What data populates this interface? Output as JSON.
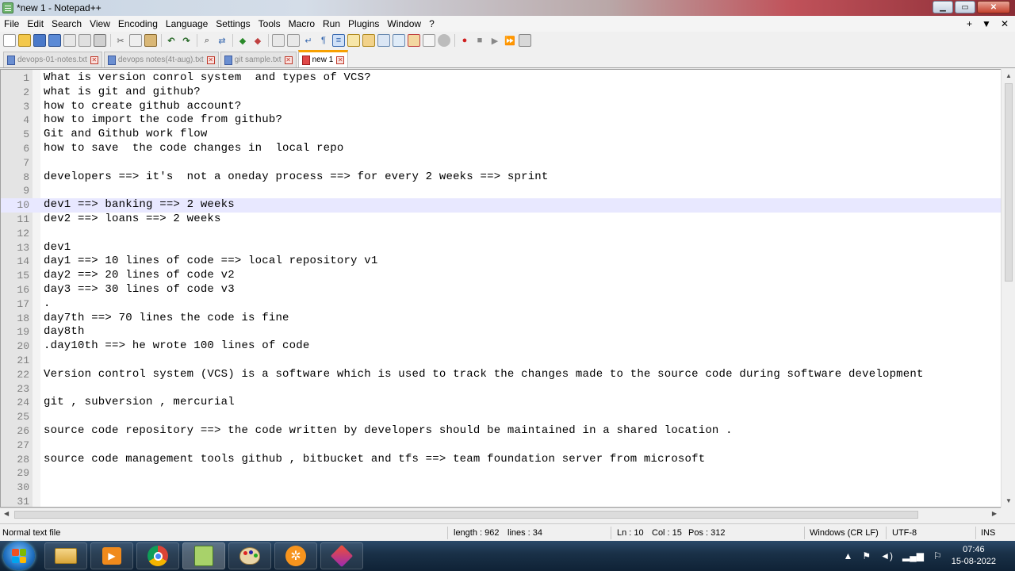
{
  "window": {
    "title": "*new 1 - Notepad++"
  },
  "menu": [
    "File",
    "Edit",
    "Search",
    "View",
    "Encoding",
    "Language",
    "Settings",
    "Tools",
    "Macro",
    "Run",
    "Plugins",
    "Window",
    "?"
  ],
  "menu_right": {
    "add": "+",
    "dropdown": "▼",
    "close": "✕"
  },
  "tabs": [
    {
      "label": "devops-01-notes.txt",
      "active": false
    },
    {
      "label": "devops notes(4t-aug).txt",
      "active": false
    },
    {
      "label": "git sample.txt",
      "active": false
    },
    {
      "label": "new 1",
      "active": true
    }
  ],
  "editor": {
    "current_line": 10,
    "lines": [
      "What is version conrol system  and types of VCS?",
      "what is git and github?",
      "how to create github account?",
      "how to import the code from github?",
      "Git and Github work flow",
      "how to save  the code changes in  local repo",
      "",
      "developers ==> it's  not a oneday process ==> for every 2 weeks ==> sprint",
      "",
      "dev1 ==> banking ==> 2 weeks",
      "dev2 ==> loans ==> 2 weeks",
      "",
      "dev1",
      "day1 ==> 10 lines of code ==> local repository v1",
      "day2 ==> 20 lines of code v2",
      "day3 ==> 30 lines of code v3",
      ".",
      "day7th ==> 70 lines the code is fine",
      "day8th",
      ".day10th ==> he wrote 100 lines of code",
      "",
      "Version control system (VCS) is a software which is used to track the changes made to the source code during software development",
      "",
      "git , subversion , mercurial",
      "",
      "source code repository ==> the code written by developers should be maintained in a shared location .",
      "",
      "source code management tools github , bitbucket and tfs ==> team foundation server from microsoft",
      "",
      "",
      ""
    ]
  },
  "status": {
    "type": "Normal text file",
    "length": "length : 962",
    "lines": "lines : 34",
    "ln": "Ln : 10",
    "col": "Col : 15",
    "pos": "Pos : 312",
    "eol": "Windows (CR LF)",
    "encoding": "UTF-8",
    "mode": "INS"
  },
  "taskbar": {
    "time": "07:46",
    "date": "15-08-2022"
  }
}
